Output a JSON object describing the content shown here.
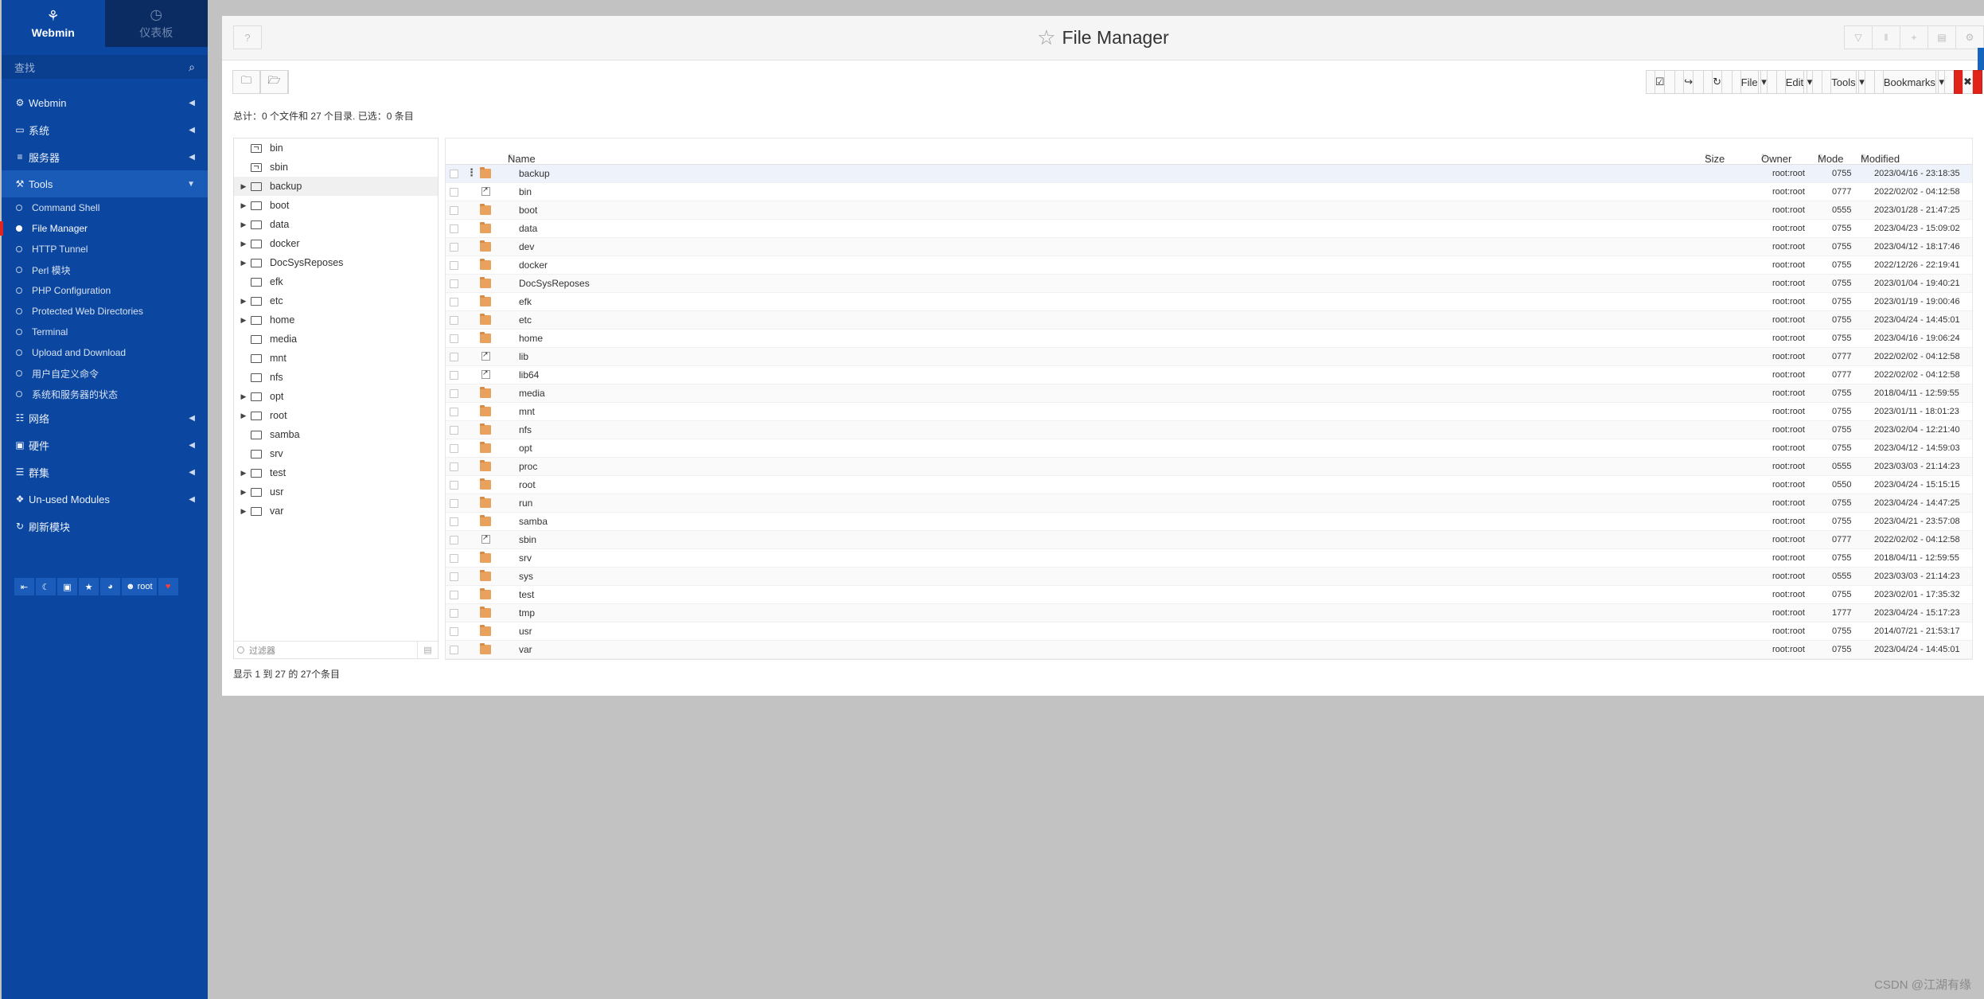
{
  "sidebar": {
    "tab_webmin": "Webmin",
    "tab_dashboard": "仪表板",
    "search_placeholder": "查找",
    "menu": {
      "webmin": "Webmin",
      "system": "系统",
      "servers": "服务器",
      "tools": "Tools",
      "network": "网络",
      "hardware": "硬件",
      "cluster": "群集",
      "unused": "Un-used Modules",
      "refresh": "刷新模块"
    },
    "tools_sub": [
      "Command Shell",
      "File Manager",
      "HTTP Tunnel",
      "Perl 模块",
      "PHP Configuration",
      "Protected Web Directories",
      "Terminal",
      "Upload and Download",
      "用户自定义命令",
      "系统和服务器的状态"
    ],
    "user": "root"
  },
  "page": {
    "title": "File Manager",
    "summary": "总计：0 个文件和 27 个目录. 已选：0 条目",
    "paging": "显示 1 到 27 的 27个条目",
    "filter_placeholder": "过滤器"
  },
  "toolbar": {
    "file": "File",
    "edit": "Edit",
    "tools": "Tools",
    "bookmarks": "Bookmarks"
  },
  "columns": {
    "name": "Name",
    "size": "Size",
    "owner": "Owner",
    "mode": "Mode",
    "modified": "Modified"
  },
  "tree": [
    {
      "name": "bin",
      "arrow": false,
      "link": true
    },
    {
      "name": "sbin",
      "arrow": false,
      "link": true
    },
    {
      "name": "backup",
      "arrow": true,
      "link": false
    },
    {
      "name": "boot",
      "arrow": true,
      "link": false
    },
    {
      "name": "data",
      "arrow": true,
      "link": false
    },
    {
      "name": "docker",
      "arrow": true,
      "link": false
    },
    {
      "name": "DocSysReposes",
      "arrow": true,
      "link": false
    },
    {
      "name": "efk",
      "arrow": false,
      "link": false
    },
    {
      "name": "etc",
      "arrow": true,
      "link": false
    },
    {
      "name": "home",
      "arrow": true,
      "link": false
    },
    {
      "name": "media",
      "arrow": false,
      "link": false
    },
    {
      "name": "mnt",
      "arrow": false,
      "link": false
    },
    {
      "name": "nfs",
      "arrow": false,
      "link": false
    },
    {
      "name": "opt",
      "arrow": true,
      "link": false
    },
    {
      "name": "root",
      "arrow": true,
      "link": false
    },
    {
      "name": "samba",
      "arrow": false,
      "link": false
    },
    {
      "name": "srv",
      "arrow": false,
      "link": false
    },
    {
      "name": "test",
      "arrow": true,
      "link": false
    },
    {
      "name": "usr",
      "arrow": true,
      "link": false
    },
    {
      "name": "var",
      "arrow": true,
      "link": false
    }
  ],
  "files": [
    {
      "name": "backup",
      "type": "folder",
      "owner": "root:root",
      "mode": "0755",
      "modified": "2023/04/16 - 23:18:35"
    },
    {
      "name": "bin",
      "type": "link",
      "owner": "root:root",
      "mode": "0777",
      "modified": "2022/02/02 - 04:12:58"
    },
    {
      "name": "boot",
      "type": "folder",
      "owner": "root:root",
      "mode": "0555",
      "modified": "2023/01/28 - 21:47:25"
    },
    {
      "name": "data",
      "type": "folder",
      "owner": "root:root",
      "mode": "0755",
      "modified": "2023/04/23 - 15:09:02"
    },
    {
      "name": "dev",
      "type": "folder",
      "owner": "root:root",
      "mode": "0755",
      "modified": "2023/04/12 - 18:17:46"
    },
    {
      "name": "docker",
      "type": "folder",
      "owner": "root:root",
      "mode": "0755",
      "modified": "2022/12/26 - 22:19:41"
    },
    {
      "name": "DocSysReposes",
      "type": "folder",
      "owner": "root:root",
      "mode": "0755",
      "modified": "2023/01/04 - 19:40:21"
    },
    {
      "name": "efk",
      "type": "folder",
      "owner": "root:root",
      "mode": "0755",
      "modified": "2023/01/19 - 19:00:46"
    },
    {
      "name": "etc",
      "type": "folder",
      "owner": "root:root",
      "mode": "0755",
      "modified": "2023/04/24 - 14:45:01"
    },
    {
      "name": "home",
      "type": "folder",
      "owner": "root:root",
      "mode": "0755",
      "modified": "2023/04/16 - 19:06:24"
    },
    {
      "name": "lib",
      "type": "link",
      "owner": "root:root",
      "mode": "0777",
      "modified": "2022/02/02 - 04:12:58"
    },
    {
      "name": "lib64",
      "type": "link",
      "owner": "root:root",
      "mode": "0777",
      "modified": "2022/02/02 - 04:12:58"
    },
    {
      "name": "media",
      "type": "folder",
      "owner": "root:root",
      "mode": "0755",
      "modified": "2018/04/11 - 12:59:55"
    },
    {
      "name": "mnt",
      "type": "folder",
      "owner": "root:root",
      "mode": "0755",
      "modified": "2023/01/11 - 18:01:23"
    },
    {
      "name": "nfs",
      "type": "folder",
      "owner": "root:root",
      "mode": "0755",
      "modified": "2023/02/04 - 12:21:40"
    },
    {
      "name": "opt",
      "type": "folder",
      "owner": "root:root",
      "mode": "0755",
      "modified": "2023/04/12 - 14:59:03"
    },
    {
      "name": "proc",
      "type": "folder",
      "owner": "root:root",
      "mode": "0555",
      "modified": "2023/03/03 - 21:14:23"
    },
    {
      "name": "root",
      "type": "folder",
      "owner": "root:root",
      "mode": "0550",
      "modified": "2023/04/24 - 15:15:15"
    },
    {
      "name": "run",
      "type": "folder",
      "owner": "root:root",
      "mode": "0755",
      "modified": "2023/04/24 - 14:47:25"
    },
    {
      "name": "samba",
      "type": "folder",
      "owner": "root:root",
      "mode": "0755",
      "modified": "2023/04/21 - 23:57:08"
    },
    {
      "name": "sbin",
      "type": "link",
      "owner": "root:root",
      "mode": "0777",
      "modified": "2022/02/02 - 04:12:58"
    },
    {
      "name": "srv",
      "type": "folder",
      "owner": "root:root",
      "mode": "0755",
      "modified": "2018/04/11 - 12:59:55"
    },
    {
      "name": "sys",
      "type": "folder",
      "owner": "root:root",
      "mode": "0555",
      "modified": "2023/03/03 - 21:14:23"
    },
    {
      "name": "test",
      "type": "folder",
      "owner": "root:root",
      "mode": "0755",
      "modified": "2023/02/01 - 17:35:32"
    },
    {
      "name": "tmp",
      "type": "folder",
      "owner": "root:root",
      "mode": "1777",
      "modified": "2023/04/24 - 15:17:23"
    },
    {
      "name": "usr",
      "type": "folder",
      "owner": "root:root",
      "mode": "0755",
      "modified": "2014/07/21 - 21:53:17"
    },
    {
      "name": "var",
      "type": "folder",
      "owner": "root:root",
      "mode": "0755",
      "modified": "2023/04/24 - 14:45:01"
    }
  ],
  "watermark": "CSDN @江湖有缘"
}
